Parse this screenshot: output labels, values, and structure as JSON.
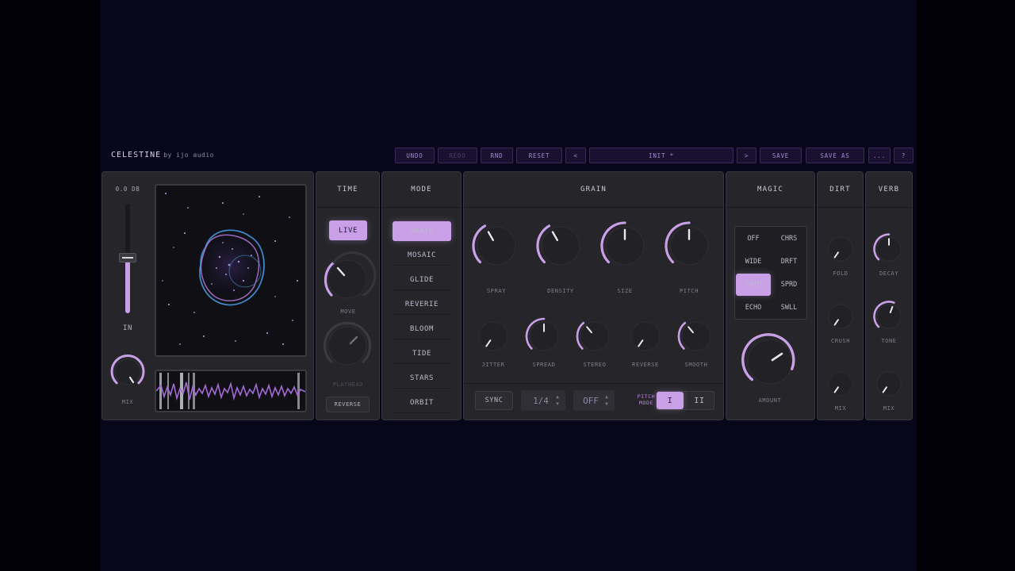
{
  "app": {
    "name": "CELESTINE",
    "vendor": "by ijo audio"
  },
  "toolbar": {
    "undo": "UNDO",
    "redo": "REDO",
    "rnd": "RND",
    "reset": "RESET",
    "prev": "<",
    "preset": "INIT *",
    "next": ">",
    "save": "SAVE",
    "save_as": "SAVE AS",
    "more": "...",
    "help": "?"
  },
  "input": {
    "db": "0.0 DB",
    "label": "IN",
    "mix_label": "MIX",
    "slider_level": 0.55
  },
  "time": {
    "title": "TIME",
    "live": "LIVE",
    "move": "MOVE",
    "playhead": "PLAYHEAD",
    "reverse": "REVERSE"
  },
  "mode": {
    "title": "MODE",
    "items": [
      "GRAIN",
      "MOSAIC",
      "GLIDE",
      "REVERIE",
      "BLOOM",
      "TIDE",
      "STARS",
      "ORBIT"
    ],
    "selected": 0
  },
  "grain": {
    "title": "GRAIN",
    "big_knobs": [
      "SPRAY",
      "DENSITY",
      "SIZE",
      "PITCH"
    ],
    "small_knobs": [
      "JITTER",
      "SPREAD",
      "STEREO",
      "REVERSE",
      "SMOOTH"
    ],
    "sync": "SYNC",
    "division": "1/4",
    "off": "OFF",
    "pitch_mode_label": "PITCH MODE",
    "pitch_mode_1": "I",
    "pitch_mode_2": "II"
  },
  "magic": {
    "title": "MAGIC",
    "grid": [
      [
        "OFF",
        "CHRS"
      ],
      [
        "WIDE",
        "DRFT"
      ],
      [
        "SHIM",
        "SPRD"
      ],
      [
        "ECHO",
        "SWLL"
      ]
    ],
    "selected": "SHIM",
    "amount": "AMOUNT"
  },
  "dirt": {
    "title": "DIRT",
    "knobs": [
      "FOLD",
      "CRUSH",
      "MIX"
    ]
  },
  "verb": {
    "title": "VERB",
    "knobs": [
      "DECAY",
      "TONE",
      "MIX"
    ]
  },
  "colors": {
    "accent": "#c9a0e8",
    "panel": "#26262a",
    "background": "#07061a",
    "visual_ring_blue": "#3f87c6"
  }
}
